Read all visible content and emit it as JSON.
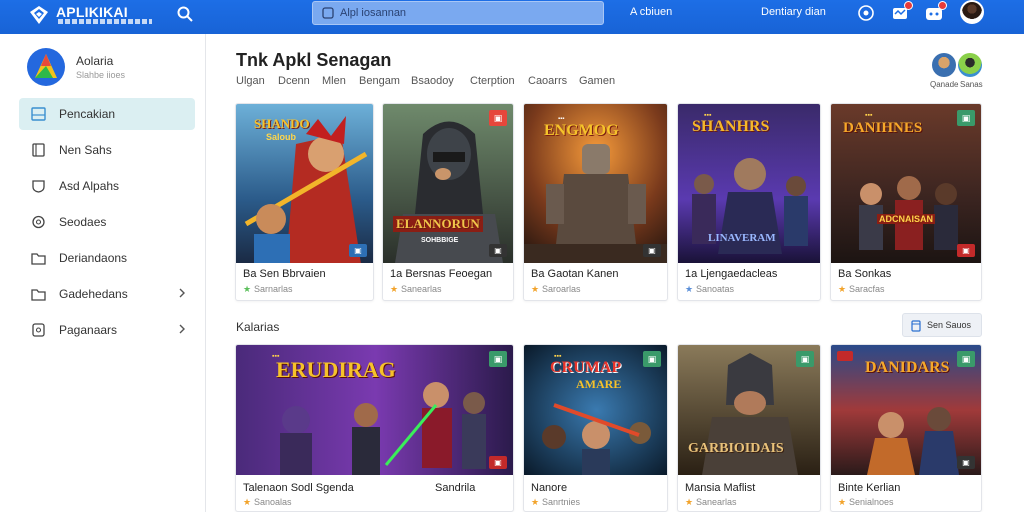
{
  "header": {
    "logo_name": "APLIKIKAI",
    "search_placeholder": "Alpl iosannan",
    "link_1": "A cbiuen",
    "link_2": "Dentiary dian",
    "colors": {
      "bar": "#1d6ee6",
      "badge": "#e63b3b"
    }
  },
  "sidebar": {
    "app_title": "Aolaria",
    "app_subtitle": "Slahbe iioes",
    "items": [
      {
        "label": "Pencakian",
        "icon": "inbox-icon",
        "active": true
      },
      {
        "label": "Nen Sahs",
        "icon": "bookmark-icon"
      },
      {
        "label": "Asd Alpahs",
        "icon": "shield-icon"
      },
      {
        "label": "Seodaes",
        "icon": "refresh-icon"
      },
      {
        "label": "Deriandaons",
        "icon": "folder-icon"
      },
      {
        "label": "Gadehedans",
        "icon": "folder-icon",
        "chevron": true
      },
      {
        "label": "Paganaars",
        "icon": "gallery-icon",
        "chevron": true
      }
    ],
    "active_color": "#dbeff2"
  },
  "main": {
    "title": "Tnk Apkl Senagan",
    "tabs": [
      "Ulgan",
      "Dcenn",
      "Mlen",
      "Bengam",
      "Bsaodoy",
      "Cterption",
      "Caoarrs",
      "Gamen"
    ],
    "mini_caps": [
      "Qanade",
      "Sanas"
    ],
    "row1": [
      {
        "poster_title": "SHANDO",
        "poster_sub": "Saloub",
        "title": "Sen Bbrvaien",
        "prefix": "Ba",
        "sub": "Sarnarlas",
        "star_color": "#5bbf5b"
      },
      {
        "poster_title": "ELANNORUN",
        "poster_sub": "SOHBBIGE",
        "title": "Bersnas Feoegan",
        "prefix": "1a",
        "sub": "Sanearlas",
        "star_color": "#f2a32b"
      },
      {
        "poster_title": "ENGMOG",
        "poster_sub": "",
        "title": "Gaotan Kanen",
        "prefix": "Ba",
        "sub": "Saroarlas",
        "star_color": "#f2a32b"
      },
      {
        "poster_title": "SHANHRS",
        "poster_sub": "LINAVERAM",
        "title": "Ljengaedacleas",
        "prefix": "1a",
        "sub": "Sanoatas",
        "star_color": "#5b8fd8"
      },
      {
        "poster_title": "DANIHNES",
        "poster_sub": "ADCNAISAN",
        "title": "Sonkas",
        "prefix": "Ba",
        "sub": "Saracfas",
        "star_color": "#f2a32b"
      }
    ],
    "section_title": "Kalarias",
    "section_button": "Sen Sauos",
    "row2": [
      {
        "poster_title": "ERUDIRAG",
        "title": "Talenaon Sodl Sgenda",
        "right": "Sandrila",
        "sub": "Sanoalas",
        "star_color": "#f2a32b"
      },
      {
        "poster_title": "CRUMAP",
        "poster_sub": "AMARE",
        "title": "Nanore",
        "sub": "Sanrtnies",
        "star_color": "#f2a32b"
      },
      {
        "poster_title": "GARBIOIDAIS",
        "title": "Mansia Maflist",
        "sub": "Sanearlas",
        "star_color": "#f2a32b"
      },
      {
        "poster_title": "DANIDARS",
        "title": "Binte Kerlian",
        "sub": "Senialnoes",
        "star_color": "#f2a32b"
      }
    ]
  }
}
